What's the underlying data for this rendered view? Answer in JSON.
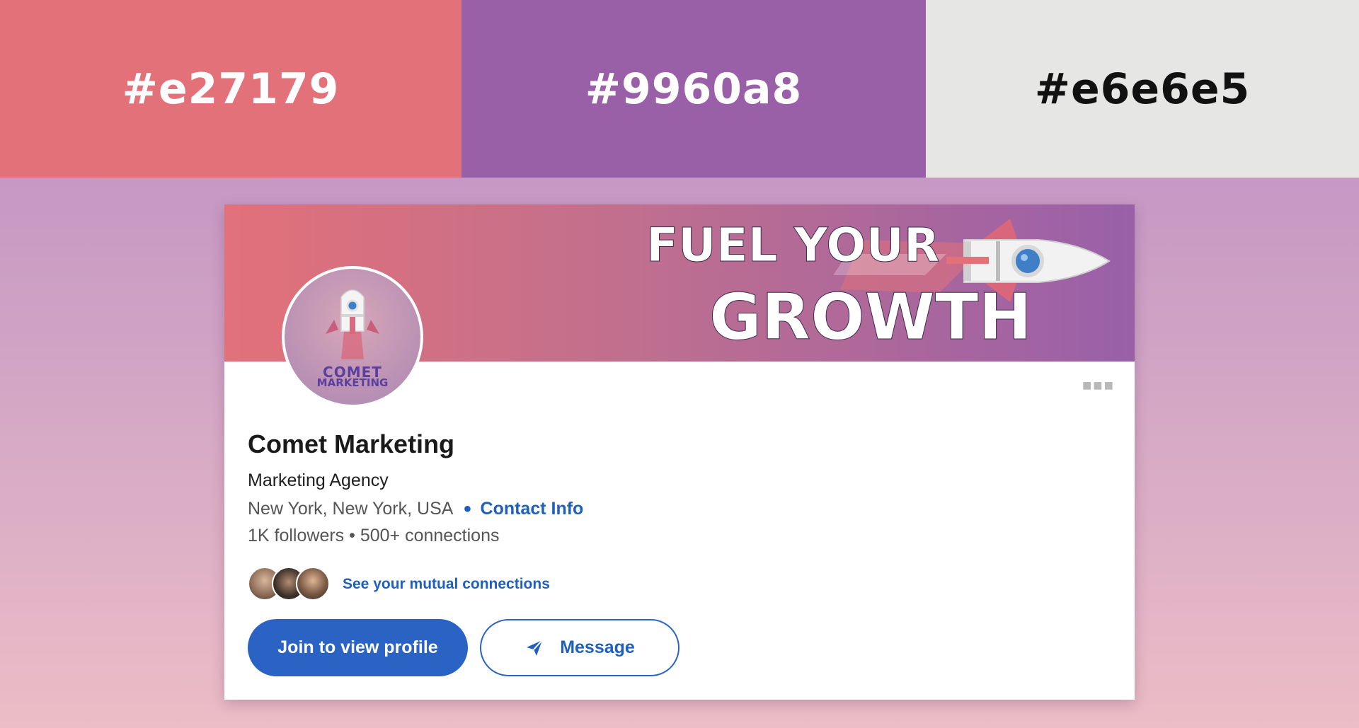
{
  "palette": {
    "swatches": [
      {
        "label": "#e27179",
        "color": "#e27179"
      },
      {
        "label": "#9960a8",
        "color": "#9960a8"
      },
      {
        "label": "#e6e6e5",
        "color": "#e6e6e5"
      }
    ]
  },
  "banner": {
    "headline_line1": "FUEL YOUR",
    "headline_line2": "GROWTH"
  },
  "logo": {
    "line1": "COMET",
    "line2": "MARKETING"
  },
  "profile": {
    "name": "Comet Marketing",
    "industry": "Marketing Agency",
    "location": "New York, New York, USA",
    "contact_link": "Contact Info",
    "stats": "1K followers • 500+ connections",
    "mutual_link": "See your mutual connections"
  },
  "actions": {
    "join_label": "Join to view profile",
    "message_label": "Message"
  },
  "colors": {
    "link_blue": "#1f5fbf",
    "button_blue": "#2a63c4"
  }
}
